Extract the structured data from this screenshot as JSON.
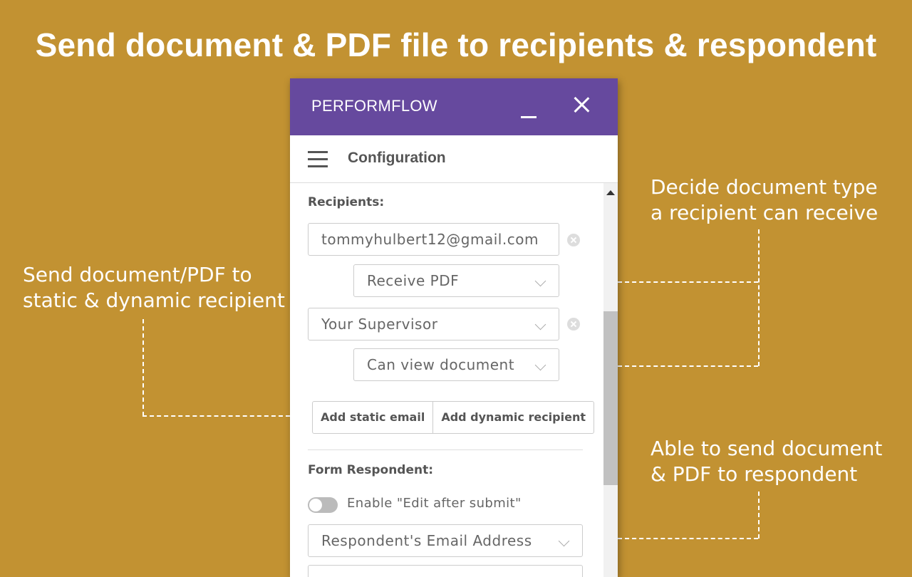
{
  "headline": "Send document & PDF file to recipients & respondent",
  "callouts": {
    "left": [
      "Send document/PDF to",
      "static & dynamic recipient"
    ],
    "right_top": [
      "Decide document type",
      "a recipient can receive"
    ],
    "right_bottom": [
      "Able to send document",
      "& PDF to respondent"
    ]
  },
  "window": {
    "title": "PERFORMFLOW",
    "minimize_icon": "minimize-icon",
    "close_icon": "close-icon"
  },
  "header": {
    "menu_icon": "hamburger-menu-icon",
    "title": "Configuration"
  },
  "recipients": {
    "label": "Recipients:",
    "items": [
      {
        "value": "tommyhulbert12@gmail.com",
        "permission": "Receive PDF"
      },
      {
        "value": "Your Supervisor",
        "permission": "Can view document"
      }
    ],
    "add_static_label": "Add static email",
    "add_dynamic_label": "Add dynamic recipient"
  },
  "respondent": {
    "label": "Form Respondent:",
    "toggle_label": "Enable \"Edit after submit\"",
    "toggle_on": false,
    "email_select": "Respondent's Email Address"
  },
  "colors": {
    "background": "#C29232",
    "titlebar": "#66499E"
  }
}
